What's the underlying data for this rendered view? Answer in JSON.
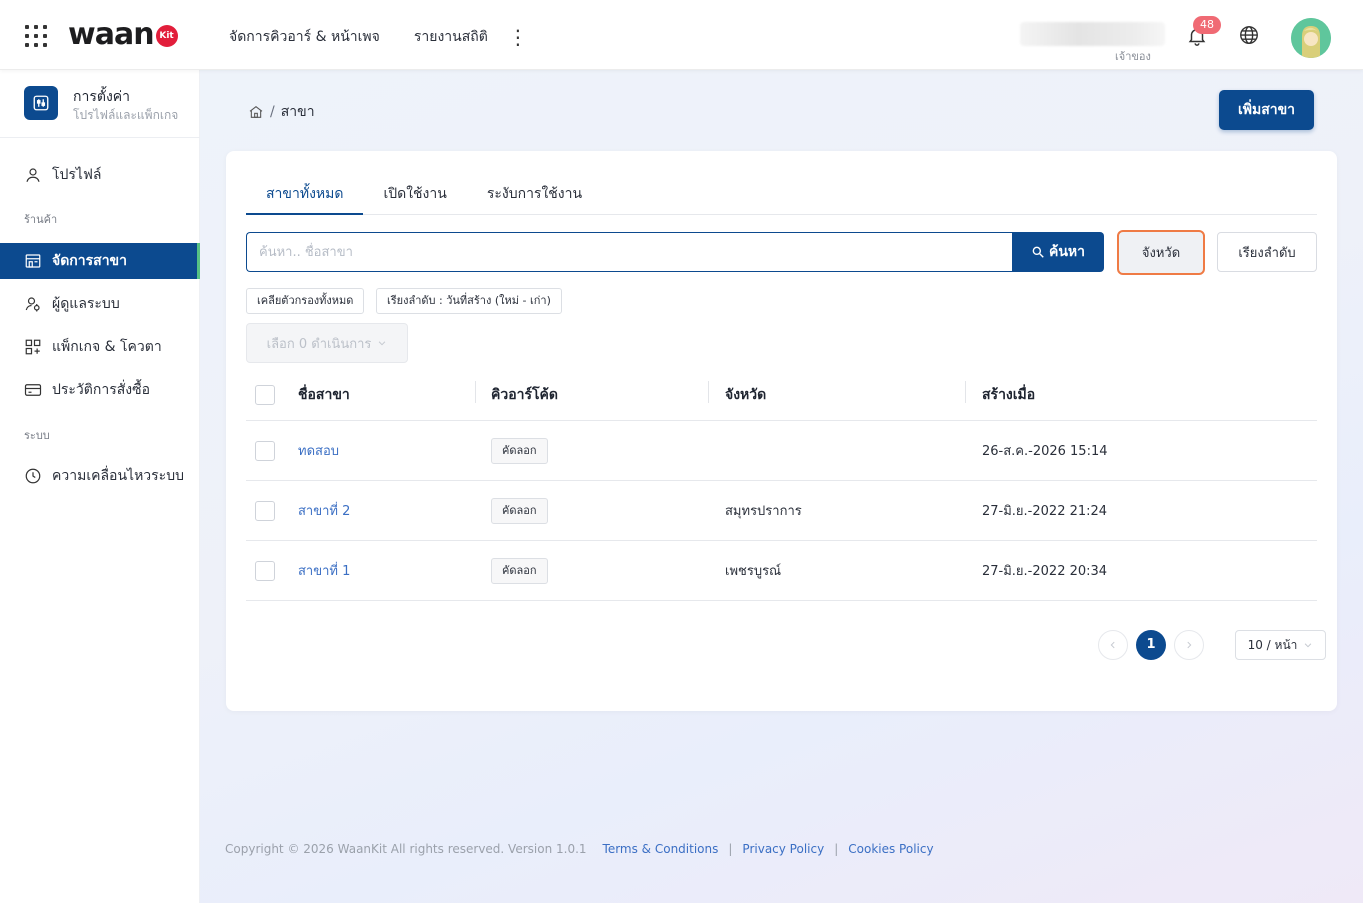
{
  "header": {
    "logo_text": "waan",
    "logo_badge": "Kit",
    "nav": [
      "จัดการคิวอาร์ & หน้าเพจ",
      "รายงานสถิติ"
    ],
    "user_role": "เจ้าของ",
    "notification_count": "48"
  },
  "sidebar": {
    "title": "การตั้งค่า",
    "subtitle": "โปรไฟล์และแพ็กเกจ",
    "profile": "โปรไฟล์",
    "group_store": "ร้านค้า",
    "branches": "จัดการสาขา",
    "users": "ผู้ดูแลระบบ",
    "packages": "แพ็กเกจ & โควตา",
    "orders": "ประวัติการสั่งซื้อ",
    "group_system": "ระบบ",
    "activity": "ความเคลื่อนไหวระบบ"
  },
  "breadcrumb": {
    "current": "สาขา"
  },
  "add_button": "เพิ่มสาขา",
  "tabs": [
    "สาขาทั้งหมด",
    "เปิดใช้งาน",
    "ระงับการใช้งาน"
  ],
  "search": {
    "placeholder": "ค้นหา.. ชื่อสาขา",
    "button": "ค้นหา"
  },
  "province_button": "จังหวัด",
  "sort_button": "เรียงลำดับ",
  "chips": {
    "clear": "เคลียตัวกรองทั้งหมด",
    "sort": "เรียงลำดับ : วันที่สร้าง (ใหม่ - เก่า)"
  },
  "bulk_action": "เลือก 0 ดำเนินการ",
  "table": {
    "columns": [
      "ชื่อสาขา",
      "คิวอาร์โค้ด",
      "จังหวัด",
      "สร้างเมื่อ"
    ],
    "copy_label": "คัดลอก",
    "rows": [
      {
        "name": "ทดสอบ",
        "province": "",
        "created": "26-ส.ค.-2026 15:14"
      },
      {
        "name": "สาขาที่ 2",
        "province": "สมุทรปราการ",
        "created": "27-มิ.ย.-2022 21:24"
      },
      {
        "name": "สาขาที่ 1",
        "province": "เพชรบูรณ์",
        "created": "27-มิ.ย.-2022 20:34"
      }
    ]
  },
  "pagination": {
    "current": "1",
    "page_size": "10 / หน้า"
  },
  "footer": {
    "copyright": "Copyright © 2026 WaanKit All rights reserved. Version 1.0.1",
    "terms": "Terms & Conditions",
    "privacy": "Privacy Policy",
    "cookies": "Cookies Policy"
  },
  "colors": {
    "primary": "#0c4a8f",
    "accent_outline": "#ef7b45",
    "link": "#3b6fc4",
    "badge": "#f06a74"
  },
  "icons": [
    "apps-grid-icon",
    "bell-icon",
    "globe-icon",
    "settings-sliders-icon",
    "user-icon",
    "store-icon",
    "admin-users-icon",
    "package-icon",
    "credit-card-icon",
    "clock-icon",
    "home-icon",
    "search-icon",
    "chevron-down-icon",
    "chevron-left-icon",
    "chevron-right-icon"
  ]
}
